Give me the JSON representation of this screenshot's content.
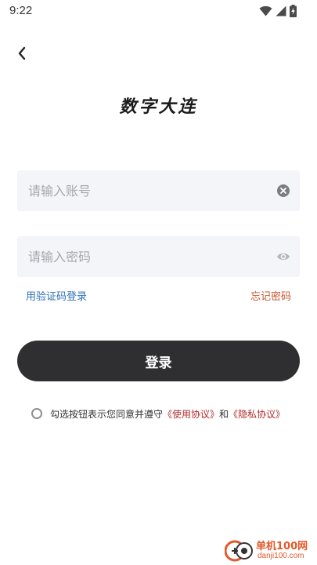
{
  "status_bar": {
    "time": "9:22"
  },
  "app": {
    "title": "数字大连"
  },
  "form": {
    "account_placeholder": "请输入账号",
    "password_placeholder": "请输入密码",
    "sms_login_label": "用验证码登录",
    "forgot_password_label": "忘记密码",
    "login_button_label": "登录"
  },
  "agreement": {
    "prefix": "勾选按钮表示您同意并遵守",
    "terms_link": "《使用协议》",
    "conjunction": "和",
    "privacy_link": "《隐私协议》",
    "checked": false
  },
  "watermark": {
    "line1": "单机100网",
    "line2": "danji100.com"
  },
  "icons": {
    "back": "chevron-left-icon",
    "clear": "clear-circle-icon",
    "visibility": "eye-icon",
    "wifi": "wifi-icon",
    "signal": "signal-icon",
    "battery": "battery-charging-icon"
  },
  "colors": {
    "primary_button": "#2f2f31",
    "input_background": "#f4f5f9",
    "sms_link": "#2f6fb6",
    "forgot_link": "#c7562f",
    "agreement_link": "#b12b2b"
  }
}
